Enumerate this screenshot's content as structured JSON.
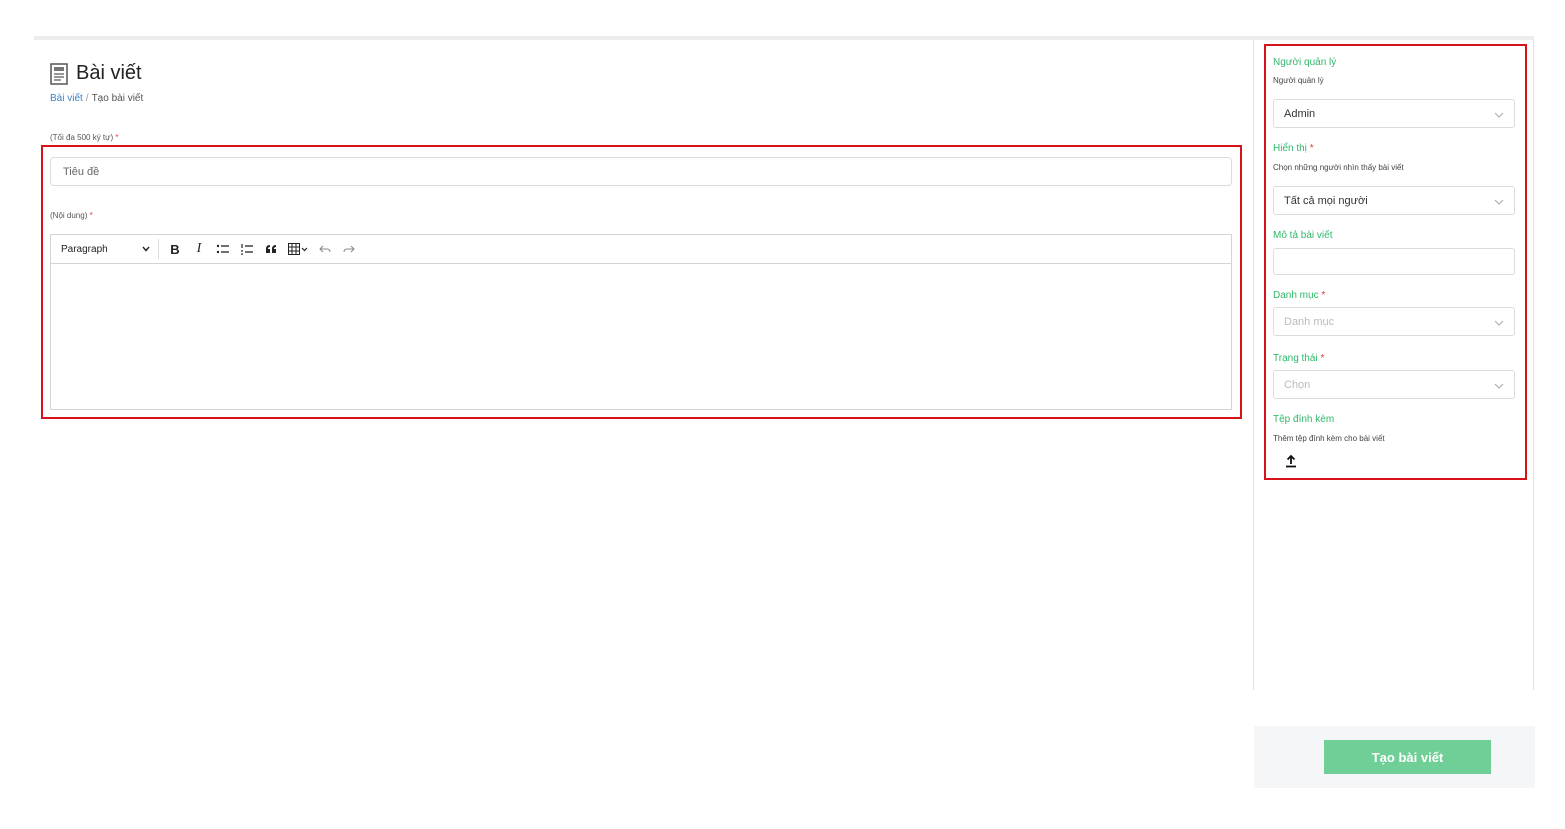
{
  "header": {
    "title": "Bài viết",
    "icon": "newspaper-icon"
  },
  "breadcrumb": {
    "link": "Bài viết",
    "separator": "/",
    "current": "Tạo bài viết"
  },
  "form": {
    "title_hint": "(Tối đa 500 ký tự)",
    "required_mark": "*",
    "title_placeholder": "Tiêu đề",
    "content_hint": "(Nội dung)",
    "editor_toolbar": {
      "paragraph_label": "Paragraph",
      "bold_label": "B",
      "italic_label": "I"
    }
  },
  "sidebar": {
    "manager": {
      "label": "Người quản lý",
      "sub": "Người quản lý",
      "value": "Admin"
    },
    "visibility": {
      "label": "Hiển thị",
      "sub": "Chọn những người nhìn thấy bài viết",
      "value": "Tất cả mọi người"
    },
    "description": {
      "label": "Mô tả bài viết",
      "value": ""
    },
    "category": {
      "label": "Danh mục",
      "placeholder": "Danh mục"
    },
    "status": {
      "label": "Trạng thái",
      "placeholder": "Chọn"
    },
    "attachment": {
      "label": "Tệp đính kèm",
      "sub": "Thêm tệp đính kèm cho bài viết"
    }
  },
  "footer": {
    "submit_label": "Tạo bài viết"
  },
  "colors": {
    "accent_green": "#2fb86a",
    "button_green": "#6fcf97",
    "highlight_red": "#d6121b",
    "link_blue": "#3b82c4"
  }
}
